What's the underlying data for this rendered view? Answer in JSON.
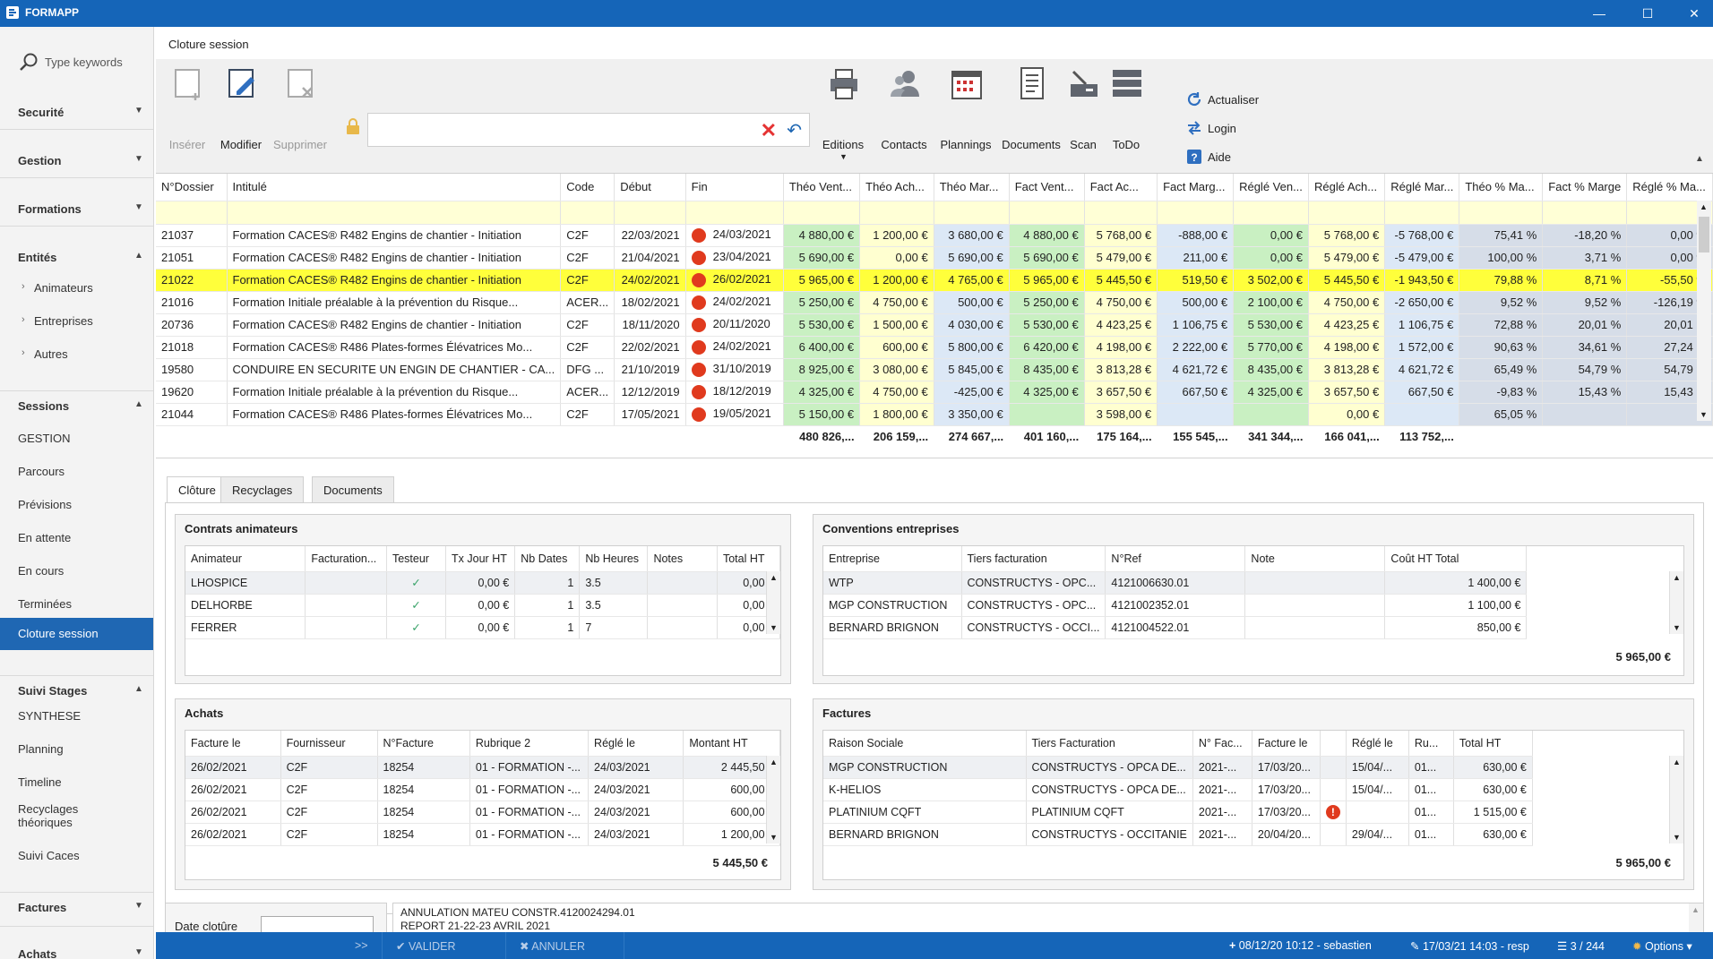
{
  "app": {
    "title": "FORMAPP"
  },
  "sidebar": {
    "search_placeholder": "Type keywords",
    "sections": {
      "securite": "Securité",
      "gestion": "Gestion",
      "formations": "Formations",
      "entites": "Entités",
      "sessions": "Sessions",
      "suivi": "Suivi Stages",
      "factures": "Factures",
      "achats": "Achats"
    },
    "entites_items": [
      "Animateurs",
      "Entreprises",
      "Autres"
    ],
    "sessions_items": [
      "GESTION",
      "Parcours",
      "Prévisions",
      "En attente",
      "En cours",
      "Terminées",
      "Cloture session"
    ],
    "suivi_items": [
      "SYNTHESE",
      "Planning",
      "Timeline",
      "Recyclages théoriques",
      "Suivi Caces"
    ]
  },
  "page": {
    "title": "Cloture session"
  },
  "ribbon": {
    "inserer": "Insérer",
    "modifier": "Modifier",
    "supprimer": "Supprimer",
    "editions": "Editions",
    "contacts": "Contacts",
    "plannings": "Plannings",
    "documents": "Documents",
    "scan": "Scan",
    "todo": "ToDo",
    "actualiser": "Actualiser",
    "login": "Login",
    "aide": "Aide"
  },
  "grid": {
    "columns": [
      "N°Dossier",
      "Intitulé",
      "Code",
      "Début",
      "Fin",
      "Théo Vent...",
      "Théo Ach...",
      "Théo Mar...",
      "Fact Vent...",
      "Fact Ac...",
      "Fact Marg...",
      "Réglé Ven...",
      "Réglé Ach...",
      "Réglé Mar...",
      "Théo % Ma...",
      "Fact % Marge",
      "Réglé % Ma..."
    ],
    "rows": [
      [
        "21037",
        "Formation CACES® R482 Engins de chantier - Initiation",
        "C2F",
        "22/03/2021",
        "24/03/2021",
        "4 880,00 €",
        "1 200,00 €",
        "3 680,00 €",
        "4 880,00 €",
        "5 768,00 €",
        "-888,00 €",
        "0,00 €",
        "5 768,00 €",
        "-5 768,00 €",
        "75,41 %",
        "-18,20 %",
        "0,00 %"
      ],
      [
        "21051",
        "Formation CACES® R482 Engins de chantier - Initiation",
        "C2F",
        "21/04/2021",
        "23/04/2021",
        "5 690,00 €",
        "0,00 €",
        "5 690,00 €",
        "5 690,00 €",
        "5 479,00 €",
        "211,00 €",
        "0,00 €",
        "5 479,00 €",
        "-5 479,00 €",
        "100,00 %",
        "3,71 %",
        "0,00 %"
      ],
      [
        "21022",
        "Formation CACES® R482 Engins de chantier - Initiation",
        "C2F",
        "24/02/2021",
        "26/02/2021",
        "5 965,00 €",
        "1 200,00 €",
        "4 765,00 €",
        "5 965,00 €",
        "5 445,50 €",
        "519,50 €",
        "3 502,00 €",
        "5 445,50 €",
        "-1 943,50 €",
        "79,88 %",
        "8,71 %",
        "-55,50 %"
      ],
      [
        "21016",
        "Formation Initiale préalable à la prévention du Risque...",
        "ACER...",
        "18/02/2021",
        "24/02/2021",
        "5 250,00 €",
        "4 750,00 €",
        "500,00 €",
        "5 250,00 €",
        "4 750,00 €",
        "500,00 €",
        "2 100,00 €",
        "4 750,00 €",
        "-2 650,00 €",
        "9,52 %",
        "9,52 %",
        "-126,19 %"
      ],
      [
        "20736",
        "Formation CACES® R482 Engins de chantier - Initiation",
        "C2F",
        "18/11/2020",
        "20/11/2020",
        "5 530,00 €",
        "1 500,00 €",
        "4 030,00 €",
        "5 530,00 €",
        "4 423,25 €",
        "1 106,75 €",
        "5 530,00 €",
        "4 423,25 €",
        "1 106,75 €",
        "72,88 %",
        "20,01 %",
        "20,01 %"
      ],
      [
        "21018",
        "Formation CACES® R486 Plates-formes Élévatrices Mo...",
        "C2F",
        "22/02/2021",
        "24/02/2021",
        "6 400,00 €",
        "600,00 €",
        "5 800,00 €",
        "6 420,00 €",
        "4 198,00 €",
        "2 222,00 €",
        "5 770,00 €",
        "4 198,00 €",
        "1 572,00 €",
        "90,63 %",
        "34,61 %",
        "27,24 %"
      ],
      [
        "19580",
        "CONDUIRE EN SECURITE UN ENGIN DE CHANTIER - CA...",
        "DFG ...",
        "21/10/2019",
        "31/10/2019",
        "8 925,00 €",
        "3 080,00 €",
        "5 845,00 €",
        "8 435,00 €",
        "3 813,28 €",
        "4 621,72 €",
        "8 435,00 €",
        "3 813,28 €",
        "4 621,72 €",
        "65,49 %",
        "54,79 %",
        "54,79 %"
      ],
      [
        "19620",
        "Formation Initiale préalable à la prévention du Risque...",
        "ACER...",
        "12/12/2019",
        "18/12/2019",
        "4 325,00 €",
        "4 750,00 €",
        "-425,00 €",
        "4 325,00 €",
        "3 657,50 €",
        "667,50 €",
        "4 325,00 €",
        "3 657,50 €",
        "667,50 €",
        "-9,83 %",
        "15,43 %",
        "15,43 %"
      ],
      [
        "21044",
        "Formation CACES® R486 Plates-formes Élévatrices Mo...",
        "C2F",
        "17/05/2021",
        "19/05/2021",
        "5 150,00 €",
        "1 800,00 €",
        "3 350,00 €",
        "",
        "3 598,00 €",
        "",
        "",
        "0,00 €",
        "",
        "65,05 %",
        "",
        ""
      ]
    ],
    "totals": [
      "480 826,...",
      "206 159,...",
      "274 667,...",
      "401 160,...",
      "175 164,...",
      "155 545,...",
      "341 344,...",
      "166 041,...",
      "113 752,..."
    ]
  },
  "tabs": [
    "Clôture",
    "Recyclages",
    "Documents"
  ],
  "contrats": {
    "title": "Contrats animateurs",
    "columns": [
      "Animateur",
      "Facturation...",
      "Testeur",
      "Tx Jour HT",
      "Nb Dates",
      "Nb Heures",
      "Notes",
      "Total HT"
    ],
    "rows": [
      [
        "LHOSPICE",
        "",
        "✓",
        "0,00 €",
        "1",
        "3.5",
        "",
        "0,00 €"
      ],
      [
        "DELHORBE",
        "",
        "✓",
        "0,00 €",
        "1",
        "3.5",
        "",
        "0,00 €"
      ],
      [
        "FERRER",
        "",
        "✓",
        "0,00 €",
        "1",
        "7",
        "",
        "0,00 €"
      ]
    ]
  },
  "conventions": {
    "title": "Conventions entreprises",
    "columns": [
      "Entreprise",
      "Tiers facturation",
      "N°Ref",
      "Note",
      "Coût HT Total"
    ],
    "rows": [
      [
        "WTP",
        "CONSTRUCTYS - OPC...",
        "4121006630.01",
        "",
        "1 400,00 €"
      ],
      [
        "MGP CONSTRUCTION",
        "CONSTRUCTYS - OPC...",
        "4121002352.01",
        "",
        "1 100,00 €"
      ],
      [
        "BERNARD BRIGNON",
        "CONSTRUCTYS - OCCI...",
        "4121004522.01",
        "",
        "850,00 €"
      ]
    ],
    "total": "5 965,00 €"
  },
  "achats": {
    "title": "Achats",
    "columns": [
      "Facture le",
      "Fournisseur",
      "N°Facture",
      "Rubrique 2",
      "Réglé le",
      "Montant HT"
    ],
    "rows": [
      [
        "26/02/2021",
        "C2F",
        "18254",
        "01 - FORMATION -...",
        "24/03/2021",
        "2 445,50 €"
      ],
      [
        "26/02/2021",
        "C2F",
        "18254",
        "01 - FORMATION -...",
        "24/03/2021",
        "600,00 €"
      ],
      [
        "26/02/2021",
        "C2F",
        "18254",
        "01 - FORMATION -...",
        "24/03/2021",
        "600,00 €"
      ],
      [
        "26/02/2021",
        "C2F",
        "18254",
        "01 - FORMATION -...",
        "24/03/2021",
        "1 200,00 €"
      ]
    ],
    "total": "5 445,50 €"
  },
  "factures": {
    "title": "Factures",
    "columns": [
      "Raison Sociale",
      "Tiers Facturation",
      "N° Fac...",
      "Facture le",
      "",
      "Réglé le",
      "Ru...",
      "Total HT"
    ],
    "rows": [
      [
        "MGP CONSTRUCTION",
        "CONSTRUCTYS - OPCA DE...",
        "2021-...",
        "17/03/20...",
        "",
        "15/04/...",
        "01...",
        "630,00 €"
      ],
      [
        "K-HELIOS",
        "CONSTRUCTYS - OPCA DE...",
        "2021-...",
        "17/03/20...",
        "",
        "15/04/...",
        "01...",
        "630,00 €"
      ],
      [
        "PLATINIUM CQFT",
        "PLATINIUM CQFT",
        "2021-...",
        "17/03/20...",
        "!",
        "",
        "01...",
        "1 515,00 €"
      ],
      [
        "BERNARD BRIGNON",
        "CONSTRUCTYS - OCCITANIE",
        "2021-...",
        "20/04/20...",
        "",
        "29/04/...",
        "01...",
        "630,00 €"
      ]
    ],
    "total": "5 965,00 €"
  },
  "cloture": {
    "date_label": "Date clotûre",
    "notes_line1": "ANNULATION MATEU CONSTR.4120024294.01",
    "notes_line2": "REPORT 21-22-23 AVRIL 2021"
  },
  "statusbar": {
    "expand": ">>",
    "valider": "VALIDER",
    "annuler": "ANNULER",
    "created": "08/12/20 10:12 - sebastien",
    "modified": "17/03/21 14:03 - resp",
    "records": "3 / 244",
    "options": "Options"
  }
}
